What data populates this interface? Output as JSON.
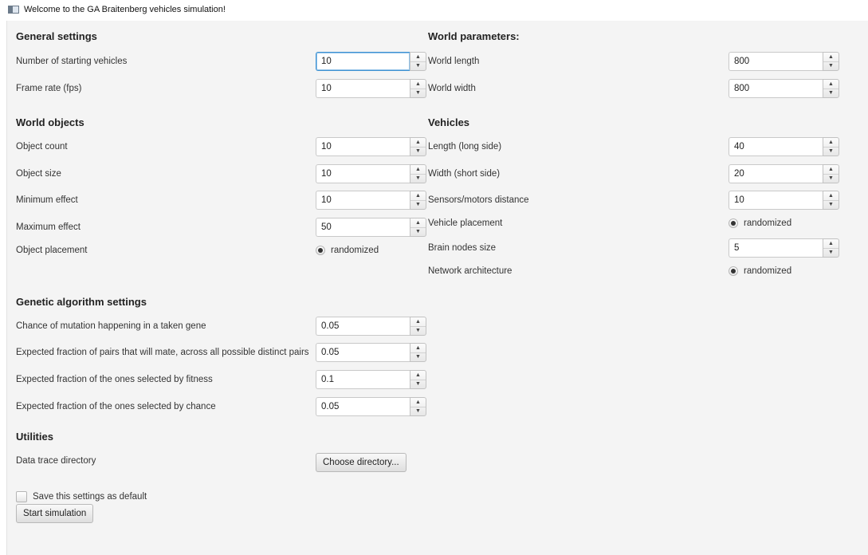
{
  "window": {
    "title": "Welcome to the GA Braitenberg vehicles simulation!"
  },
  "general": {
    "heading": "General settings",
    "vehicles_label": "Number of starting vehicles",
    "vehicles_value": "10",
    "fps_label": "Frame rate (fps)",
    "fps_value": "10"
  },
  "world_params": {
    "heading": "World parameters:",
    "length_label": "World length",
    "length_value": "800",
    "width_label": "World width",
    "width_value": "800"
  },
  "world_objects": {
    "heading": "World objects",
    "count_label": "Object count",
    "count_value": "10",
    "size_label": "Object size",
    "size_value": "10",
    "min_label": "Minimum effect",
    "min_value": "10",
    "max_label": "Maximum effect",
    "max_value": "50",
    "placement_label": "Object placement",
    "placement_option": "randomized"
  },
  "vehicles": {
    "heading": "Vehicles",
    "length_label": "Length (long side)",
    "length_value": "40",
    "width_label": "Width (short side)",
    "width_value": "20",
    "sensors_label": "Sensors/motors distance",
    "sensors_value": "10",
    "placement_label": "Vehicle placement",
    "placement_option": "randomized",
    "brain_label": "Brain nodes size",
    "brain_value": "5",
    "network_label": "Network architecture",
    "network_option": "randomized"
  },
  "genetic": {
    "heading": "Genetic algorithm settings",
    "mutation_label": "Chance of mutation happening in a taken gene",
    "mutation_value": "0.05",
    "mate_label": "Expected fraction of pairs that will mate, across all possible distinct pairs",
    "mate_value": "0.05",
    "fitness_label": "Expected fraction of the ones selected by fitness",
    "fitness_value": "0.1",
    "chance_label": "Expected fraction of the ones selected by chance",
    "chance_value": "0.05"
  },
  "utilities": {
    "heading": "Utilities",
    "trace_label": "Data trace directory",
    "choose_button": "Choose directory..."
  },
  "footer": {
    "save_default_label": "Save this settings as default",
    "start_button": "Start simulation"
  },
  "icons": {
    "spinner_up": "▲",
    "spinner_down": "▼"
  }
}
